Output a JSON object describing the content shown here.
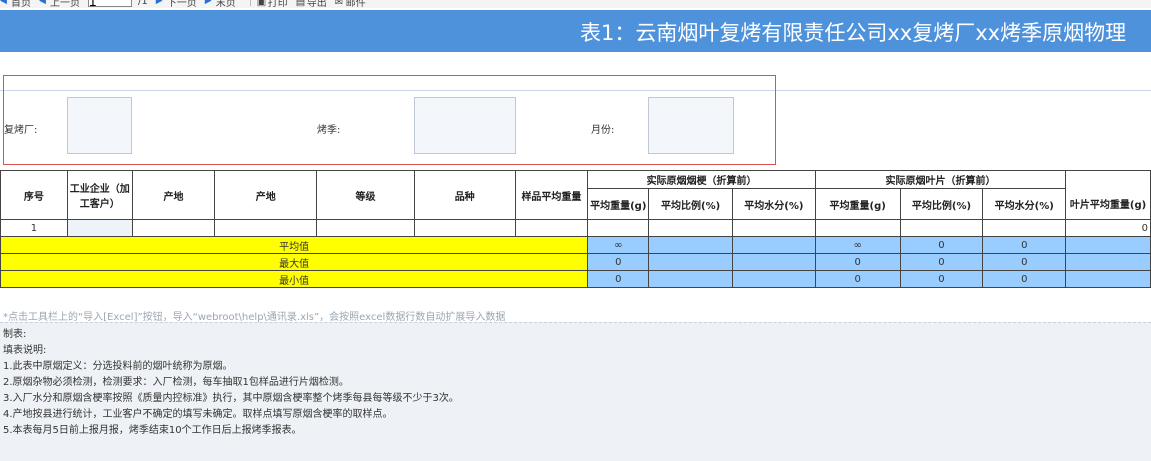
{
  "toolbar": {
    "items": [
      "首页",
      "上一页",
      "下一页",
      "末页",
      "打印",
      "导出",
      "邮件"
    ],
    "page_value": "1",
    "page_sep": "/1"
  },
  "banner": {
    "title": "表1：云南烟叶复烤有限责任公司xx复烤厂xx烤季原烟物理"
  },
  "filters": {
    "plant_label": "复烤厂:",
    "season_label": "烤季:",
    "month_label": "月份:"
  },
  "table": {
    "headers": {
      "seq": "序号",
      "company": "工业企业（加工客户）",
      "origin1": "产地",
      "origin2": "产地",
      "grade": "等级",
      "variety": "品种",
      "sample_avg": "样品平均重量",
      "stem_group": "实际原烟烟梗（折算前）",
      "leaf_group": "实际原烟叶片（折算前）",
      "avg_weight": "平均重量(g)",
      "avg_ratio": "平均比例(%)",
      "avg_moisture": "平均水分(%)",
      "leaf_avg_weight": "叶片平均重量(g)"
    },
    "row1": {
      "seq": "1",
      "last": "0"
    },
    "summary": [
      {
        "label": "平均值",
        "stem_weight": "∞",
        "leaf_weight": "∞",
        "leaf_ratio": "0",
        "leaf_moisture": "0"
      },
      {
        "label": "最大值",
        "stem_weight": "0",
        "leaf_weight": "0",
        "leaf_ratio": "0",
        "leaf_moisture": "0"
      },
      {
        "label": "最小值",
        "stem_weight": "0",
        "leaf_weight": "0",
        "leaf_ratio": "0",
        "leaf_moisture": "0"
      }
    ]
  },
  "hint": "*点击工具栏上的“导入[Excel]”按钮，导入“webroot\\help\\通讯录.xls”，会按照excel数据行数自动扩展导入数据",
  "notes": {
    "l0": "制表:",
    "l1": "填表说明:",
    "l2": "1.此表中原烟定义：分选投料前的烟叶统称为原烟。",
    "l3": "2.原烟杂物必须检测，检测要求：入厂检测，每车抽取1包样品进行片烟检测。",
    "l4": "3.入厂水分和原烟含梗率按照《质量内控标准》执行，其中原烟含梗率整个烤季每县每等级不少于3次。",
    "l5": "4.产地按县进行统计，工业客户不确定的填写未确定。取样点填写原烟含梗率的取样点。",
    "l6": "5.本表每月5日前上报月报，烤季结束10个工作日后上报烤季报表。"
  },
  "colors": {
    "banner": "#4e92dc",
    "summary_label_bg": "#ffff00",
    "summary_value_bg": "#99ccff",
    "filter_border": "#d9534f"
  }
}
